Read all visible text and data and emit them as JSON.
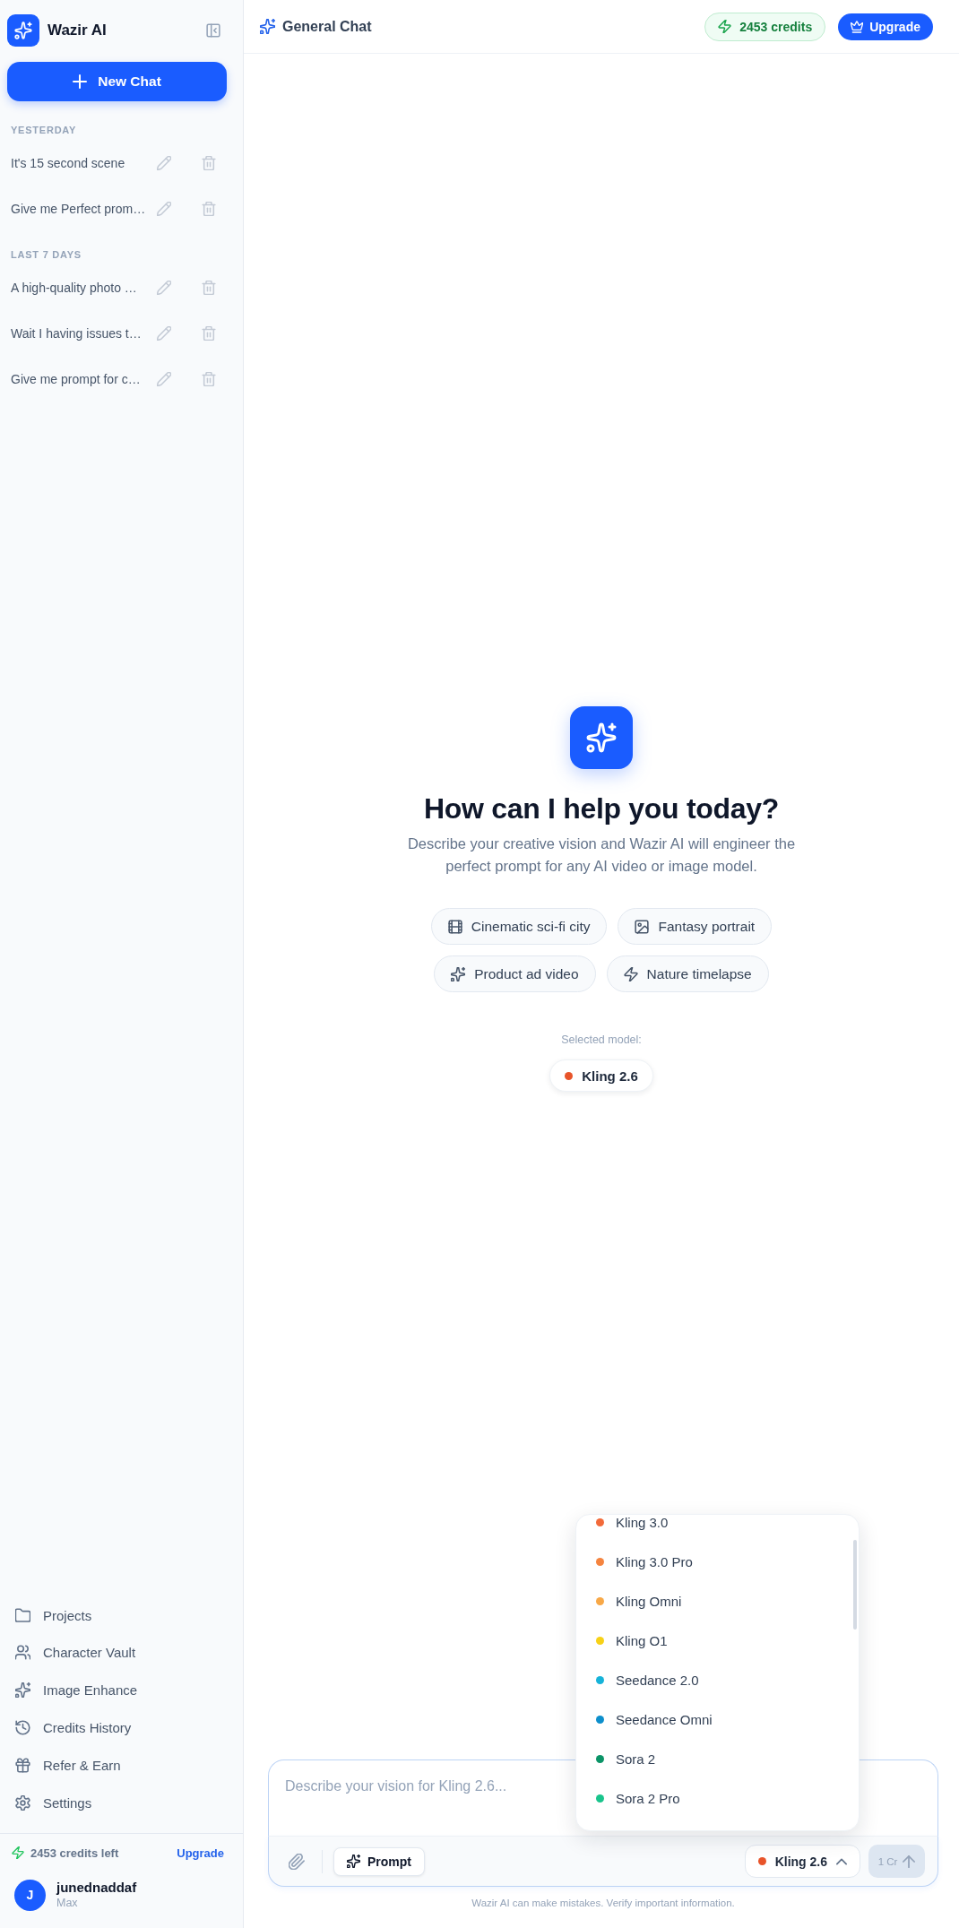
{
  "sidebar": {
    "brand": "Wazir AI",
    "new_chat": "New Chat",
    "history": [
      {
        "heading": "YESTERDAY",
        "chats": [
          "It's 15 second scene",
          "Give me Perfect prom…"
        ]
      },
      {
        "heading": "LAST 7 DAYS",
        "chats": [
          "A high-quality photo …",
          "Wait I having issues t…",
          "Give me prompt for c…"
        ]
      }
    ],
    "nav": [
      "Projects",
      "Character Vault",
      "Image Enhance",
      "Credits History",
      "Refer & Earn",
      "Settings"
    ],
    "credits": {
      "text": "2453 credits left",
      "link": "Upgrade"
    },
    "user": {
      "initial": "J",
      "name": "junednaddaf",
      "plan": "Max"
    }
  },
  "topbar": {
    "title": "General Chat",
    "credits": "2453 credits",
    "upgrade": "Upgrade"
  },
  "hero": {
    "heading": "How can I help you today?",
    "subtitle": "Describe your creative vision and Wazir AI will engineer the perfect prompt for any AI video or image model.",
    "suggestions": [
      "Cinematic sci-fi city",
      "Fantasy portrait",
      "Product ad video",
      "Nature timelapse"
    ],
    "selected_label": "Selected model:",
    "selected_model": {
      "name": "Kling 2.6",
      "color": "#e8542a"
    }
  },
  "composer": {
    "placeholder": "Describe your vision for Kling 2.6...",
    "prompt_button": "Prompt",
    "model": {
      "name": "Kling 2.6",
      "color": "#e8542a",
      "expanded": true
    },
    "model_menu": [
      {
        "name": "Kling 3.0",
        "color": "#f26a3a",
        "selected": false
      },
      {
        "name": "Kling 3.0 Pro",
        "color": "#f5843f",
        "selected": false
      },
      {
        "name": "Kling Omni",
        "color": "#f8a847",
        "selected": false
      },
      {
        "name": "Kling O1",
        "color": "#f7d117",
        "selected": false
      },
      {
        "name": "Seedance 2.0",
        "color": "#16b3d9",
        "selected": false
      },
      {
        "name": "Seedance Omni",
        "color": "#0d8fcc",
        "selected": false
      },
      {
        "name": "Sora 2",
        "color": "#0b9467",
        "selected": false
      },
      {
        "name": "Sora 2 Pro",
        "color": "#19c48c",
        "selected": false
      }
    ],
    "send": {
      "label": "1 Cr",
      "disabled": true
    }
  },
  "disclaimer": "Wazir AI can make mistakes. Verify important information."
}
